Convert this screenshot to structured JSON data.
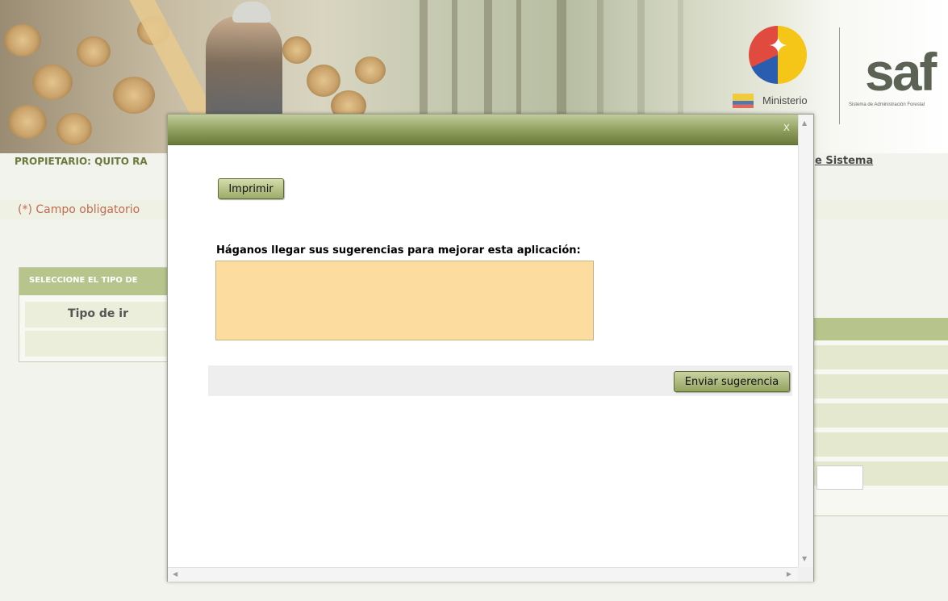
{
  "header": {
    "owner_text": "PROPIETARIO: QUITO RA",
    "ministry_label": "Ministerio",
    "saf_logo_text": "saf",
    "saf_subtitle": "Sistema de Administración Forestal",
    "manual_link": "e Sistema"
  },
  "form": {
    "required_note": "(*) Campo obligatorio",
    "select_panel_title": "SELECCIONE EL TIPO DE",
    "type_label": "Tipo de ir"
  },
  "dialog": {
    "close_label": "x",
    "print_button": "Imprimir",
    "suggestion_label": "Háganos llegar sus sugerencias para mejorar esta aplicación:",
    "suggestion_value": "",
    "send_button": "Enviar sugerencia"
  },
  "colors": {
    "accent_green": "#8e9d5c",
    "textarea_bg": "#fddc9f",
    "required_text": "#c06b52"
  }
}
